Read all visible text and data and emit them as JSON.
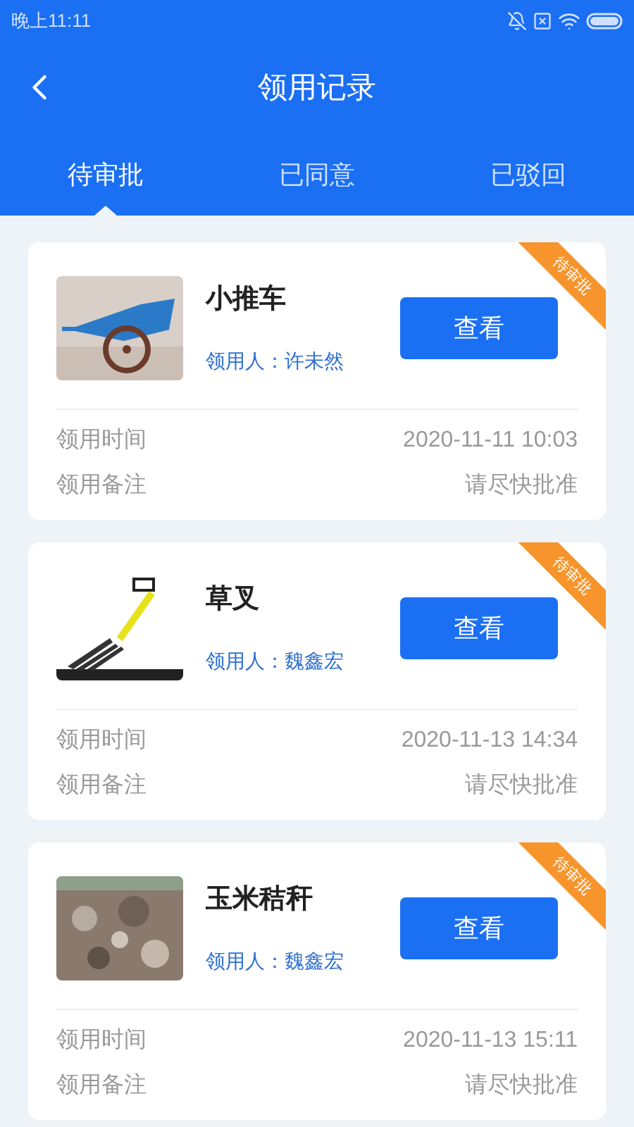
{
  "status_bar": {
    "time": "晚上11:11"
  },
  "header": {
    "title": "领用记录"
  },
  "tabs": [
    {
      "label": "待审批",
      "selected": true
    },
    {
      "label": "已同意",
      "selected": false
    },
    {
      "label": "已驳回",
      "selected": false
    }
  ],
  "records": [
    {
      "ribbon": "待审批",
      "name": "小推车",
      "applicant": "领用人：许未然",
      "button": "查看",
      "time_label": "领用时间",
      "time": "2020-11-11 10:03",
      "note_label": "领用备注",
      "note": "请尽快批准"
    },
    {
      "ribbon": "待审批",
      "name": "草叉",
      "applicant": "领用人：魏鑫宏",
      "button": "查看",
      "time_label": "领用时间",
      "time": "2020-11-13 14:34",
      "note_label": "领用备注",
      "note": "请尽快批准"
    },
    {
      "ribbon": "待审批",
      "name": "玉米秸秆",
      "applicant": "领用人：魏鑫宏",
      "button": "查看",
      "time_label": "领用时间",
      "time": "2020-11-13 15:11",
      "note_label": "领用备注",
      "note": "请尽快批准"
    }
  ]
}
